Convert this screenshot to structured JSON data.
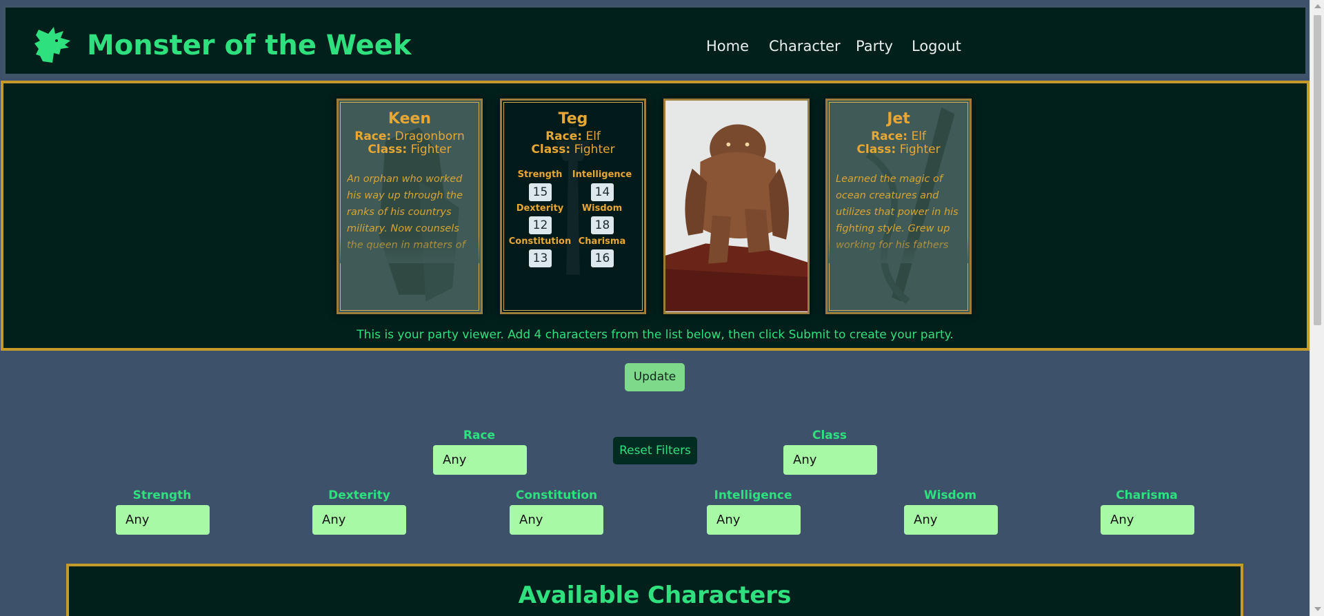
{
  "header": {
    "title": "Monster of the Week",
    "logo_icon": "dragon-head-icon",
    "nav": [
      "Home",
      "Character",
      "Party",
      "Logout"
    ]
  },
  "party_viewer": {
    "message": "This is your party viewer. Add 4 characters from the list below, then click Submit to create your party.",
    "cards": [
      {
        "name": "Keen",
        "race_label": "Race:",
        "race": "Dragonborn",
        "class_label": "Class:",
        "class": "Fighter",
        "description": "An orphan who worked his way up through the ranks of his countrys military. Now counsels the queen in matters of war. He once speared a"
      },
      {
        "name": "Teg",
        "race_label": "Race:",
        "race": "Elf",
        "class_label": "Class:",
        "class": "Fighter",
        "stats": {
          "strength_label": "Strength",
          "strength": "15",
          "intelligence_label": "Intelligence",
          "intelligence": "14",
          "dexterity_label": "Dexterity",
          "dexterity": "12",
          "wisdom_label": "Wisdom",
          "wisdom": "18",
          "constitution_label": "Constitution",
          "constitution": "13",
          "charisma_label": "Charisma",
          "charisma": "16"
        }
      },
      {
        "image": "rock-golem-monster-illustration"
      },
      {
        "name": "Jet",
        "race_label": "Race:",
        "race": "Elf",
        "class_label": "Class:",
        "class": "Fighter",
        "description": "Learned the magic of ocean creatures and utilizes that power in his fighting style. Grew up working for his fathers criminal organization,"
      }
    ]
  },
  "update_button": "Update",
  "filters": {
    "race": {
      "label": "Race",
      "value": "Any"
    },
    "class": {
      "label": "Class",
      "value": "Any"
    },
    "reset_label": "Reset Filters",
    "stats": [
      {
        "label": "Strength",
        "value": "Any"
      },
      {
        "label": "Dexterity",
        "value": "Any"
      },
      {
        "label": "Constitution",
        "value": "Any"
      },
      {
        "label": "Intelligence",
        "value": "Any"
      },
      {
        "label": "Wisdom",
        "value": "Any"
      },
      {
        "label": "Charisma",
        "value": "Any"
      }
    ]
  },
  "available": {
    "title": "Available Characters"
  },
  "colors": {
    "page_bg": "#3d526a",
    "panel_bg": "#011f1b",
    "accent_green": "#2ee07e",
    "gold": "#c49a2a",
    "select_bg": "#a8f9a6"
  }
}
